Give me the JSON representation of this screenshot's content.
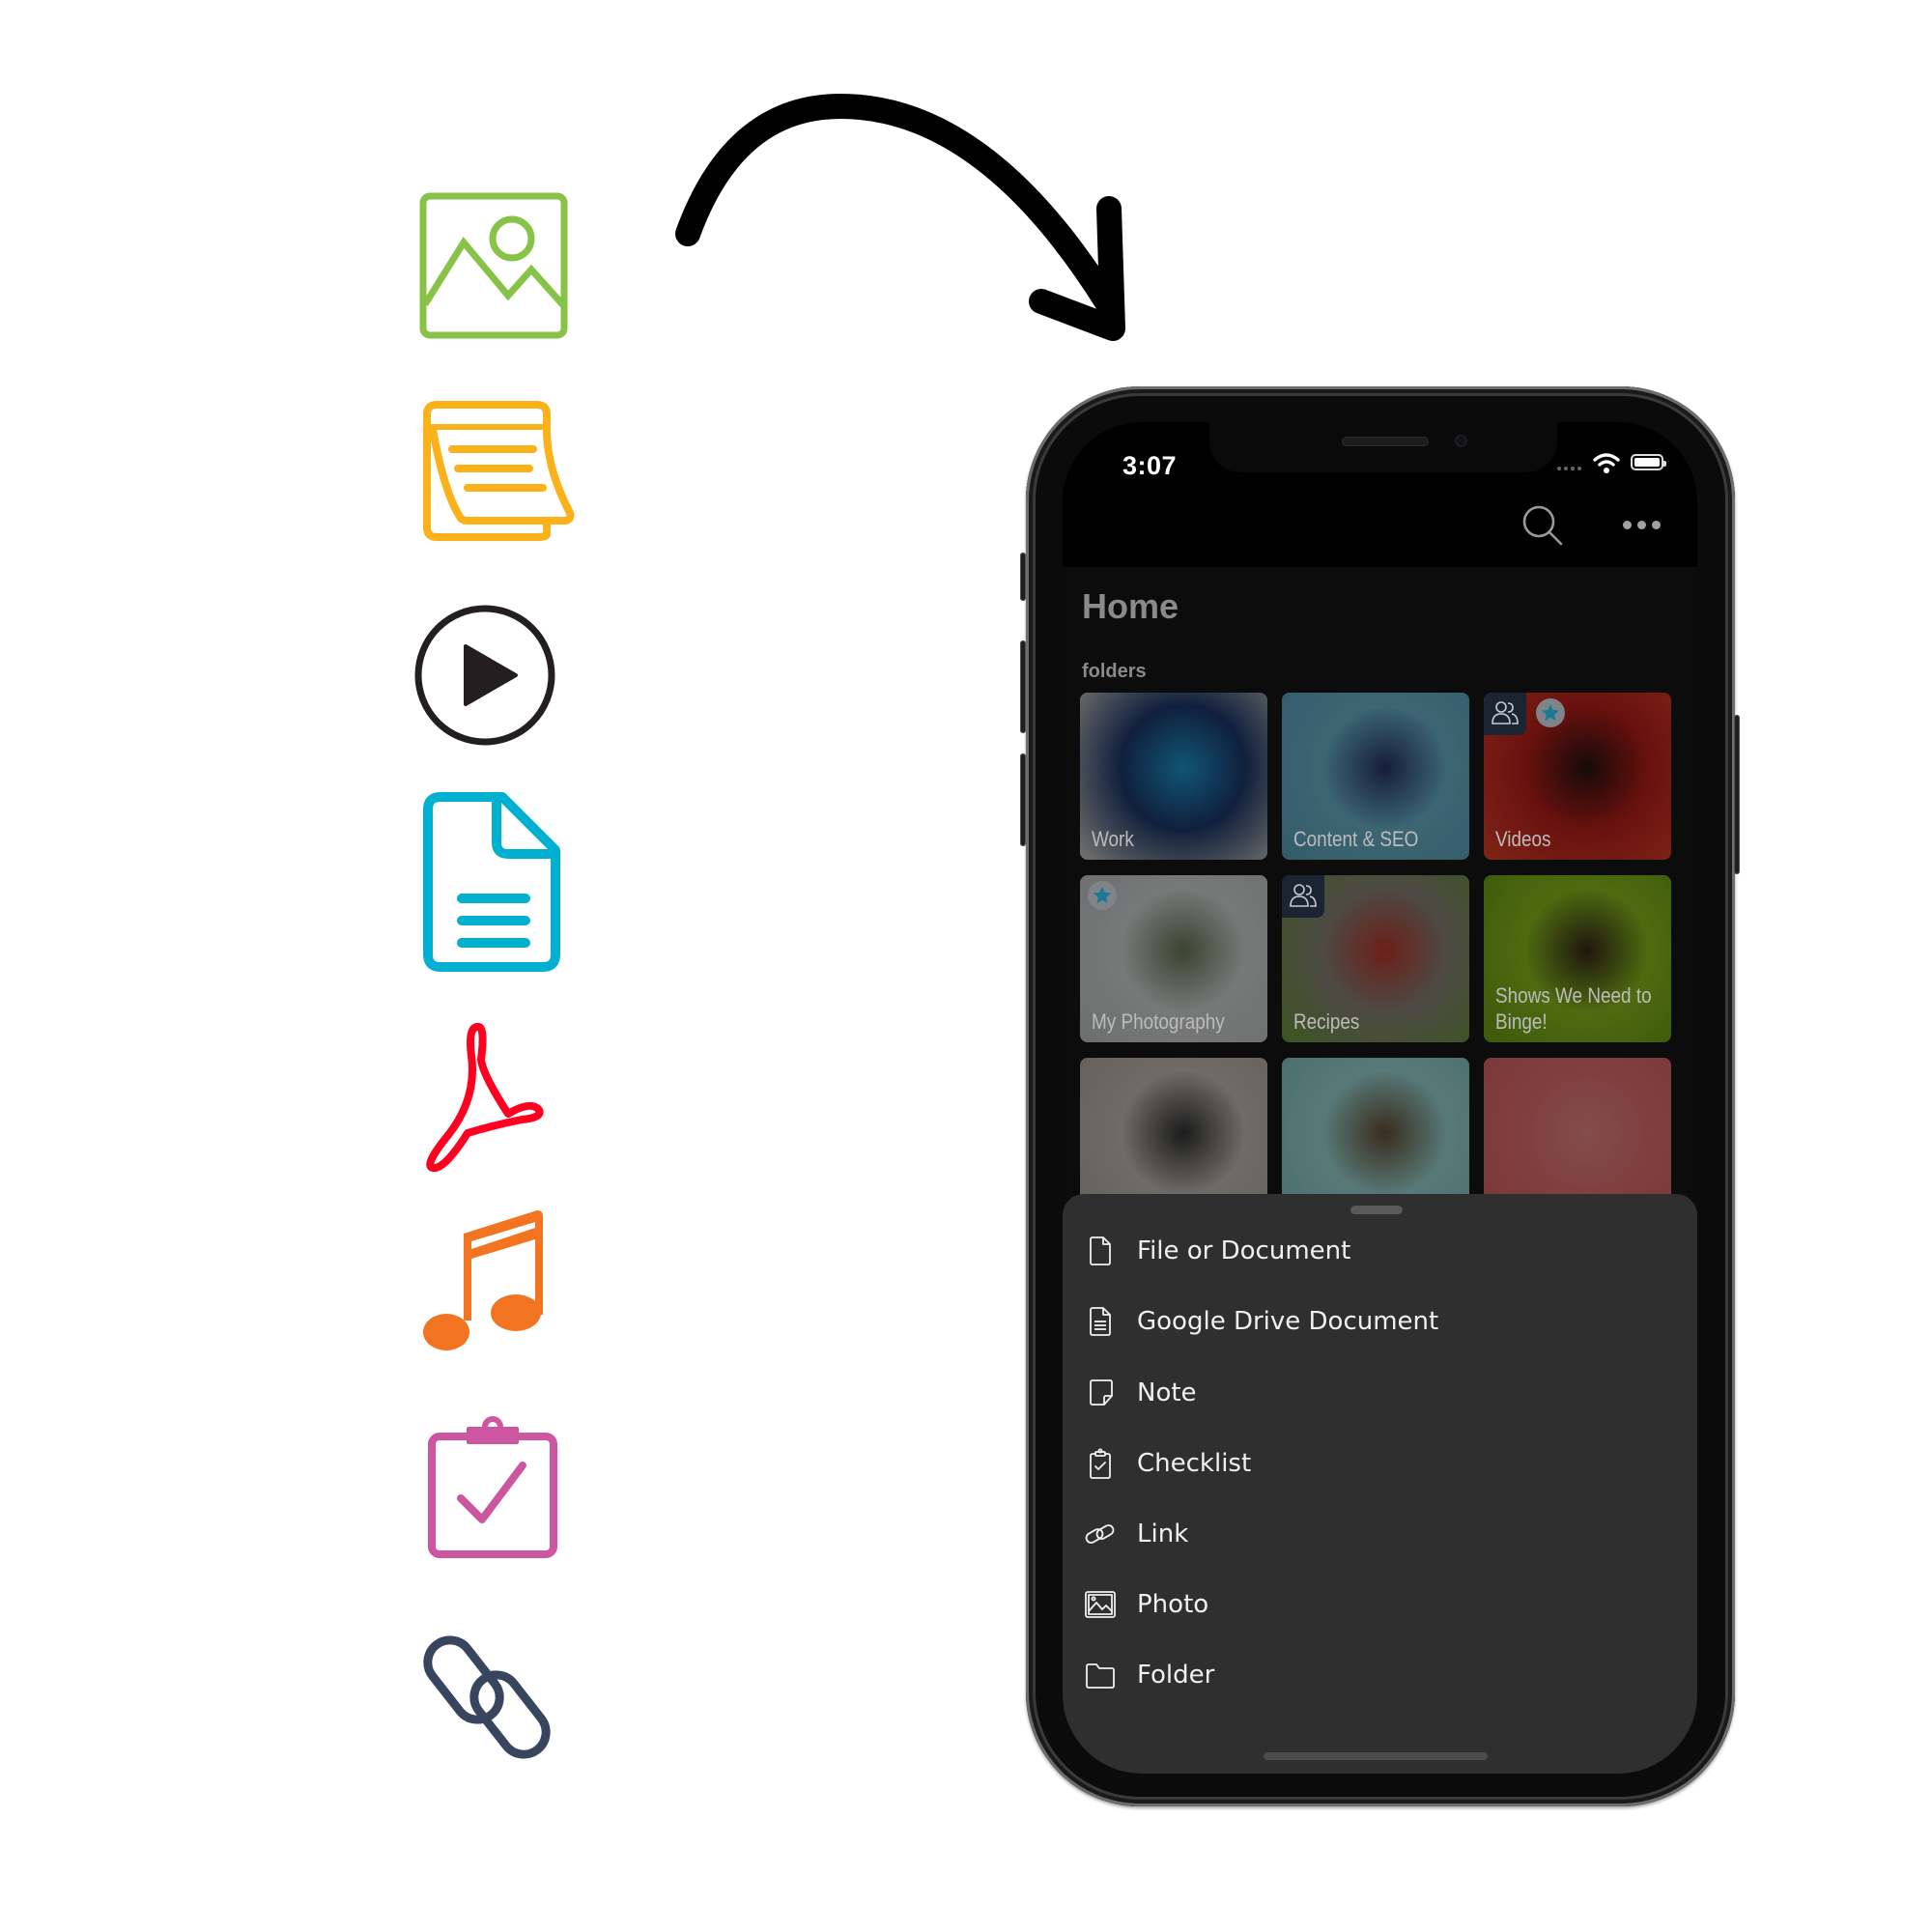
{
  "illustration": {
    "file_type_icons": [
      {
        "name": "image",
        "color": "#86c346"
      },
      {
        "name": "note",
        "color": "#fbb11a"
      },
      {
        "name": "video",
        "color": "#231f20"
      },
      {
        "name": "document",
        "color": "#00b0d0"
      },
      {
        "name": "pdf",
        "color": "#ff0020"
      },
      {
        "name": "music",
        "color": "#f37420"
      },
      {
        "name": "checklist",
        "color": "#cc57a0"
      },
      {
        "name": "link",
        "color": "#37465e"
      }
    ],
    "arrow_color": "#000000"
  },
  "status_bar": {
    "time": "3:07"
  },
  "header": {
    "search_icon": "search-icon",
    "more_icon": "more-horizontal-icon"
  },
  "page": {
    "title": "Home",
    "section_label": "folders"
  },
  "folders": [
    {
      "label": "Work",
      "shared": false,
      "starred": false,
      "colors": [
        "#1e3b6e",
        "#d7d3cc",
        "#1f9ad6"
      ]
    },
    {
      "label": "Content & SEO",
      "shared": false,
      "starred": false,
      "colors": [
        "#6fb9d1",
        "#5ea7c3",
        "#27376b"
      ]
    },
    {
      "label": "Videos",
      "shared": true,
      "starred": true,
      "colors": [
        "#c0201a",
        "#e5462a",
        "#2a1410"
      ]
    },
    {
      "label": "My Photography",
      "shared": false,
      "starred": true,
      "colors": [
        "#d9dcdd",
        "#c5c9ca",
        "#6f7b57"
      ]
    },
    {
      "label": "Recipes",
      "shared": true,
      "starred": false,
      "colors": [
        "#8d877d",
        "#6e9c3a",
        "#c43b2d"
      ]
    },
    {
      "label": "Shows We Need to Binge!",
      "shared": false,
      "starred": false,
      "colors": [
        "#8ec31e",
        "#6ea112",
        "#3a2a1b"
      ]
    },
    {
      "label": "",
      "shared": false,
      "starred": false,
      "colors": [
        "#c9c4bd",
        "#b5afa7",
        "#333"
      ]
    },
    {
      "label": "",
      "shared": false,
      "starred": false,
      "colors": [
        "#9fdcd9",
        "#88c9c7",
        "#6b5236"
      ]
    },
    {
      "label": "",
      "shared": false,
      "starred": false,
      "colors": [
        "#e87474",
        "#de6666",
        "#f08b8b"
      ]
    }
  ],
  "badges": {
    "star_color": "#1a7a94",
    "shared_bg": "#1b2433"
  },
  "add_menu": {
    "items": [
      {
        "label": "File or Document",
        "icon": "file-icon"
      },
      {
        "label": "Google Drive Document",
        "icon": "google-drive-document-icon"
      },
      {
        "label": "Note",
        "icon": "note-icon"
      },
      {
        "label": "Checklist",
        "icon": "checklist-icon"
      },
      {
        "label": "Link",
        "icon": "link-icon"
      },
      {
        "label": "Photo",
        "icon": "photo-icon"
      },
      {
        "label": "Folder",
        "icon": "folder-icon"
      }
    ]
  }
}
